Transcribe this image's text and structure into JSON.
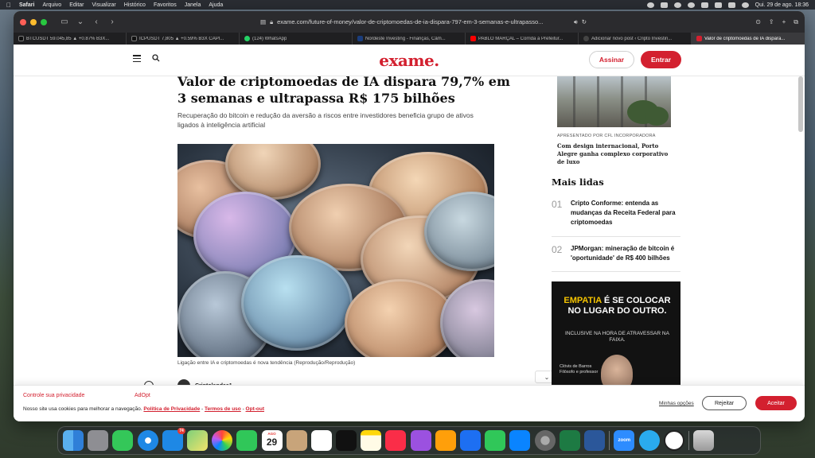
{
  "menubar": {
    "app": "Safari",
    "items": [
      "Arquivo",
      "Editar",
      "Visualizar",
      "Histórico",
      "Favoritos",
      "Janela",
      "Ajuda"
    ],
    "clock": "Qui. 29 de ago.  18:36"
  },
  "browser": {
    "url": "exame.com/future-of-money/valor-de-criptomoedas-de-ia-dispara-797-em-3-semanas-e-ultrapasso...",
    "tabs": [
      {
        "label": "BTCUSDT 59.045,85 ▲ +0.87% B3X...",
        "color": "#111111"
      },
      {
        "label": "ICPUSDT 7,805 ▲ +0.59% B3X CAPI...",
        "color": "#111111"
      },
      {
        "label": "(124) WhatsApp",
        "color": "#25d366"
      },
      {
        "label": "Nordeste Investing - Finanças, Câm...",
        "color": "#1a3d7c"
      },
      {
        "label": "PABLO MARÇAL – Corrida à Prefeitur...",
        "color": "#ff0000"
      },
      {
        "label": "Adicionar novo post ‹ Cripto Investin...",
        "color": "#444444"
      },
      {
        "label": "Valor de criptomoedas de IA dispara...",
        "color": "#d3202f"
      }
    ]
  },
  "header": {
    "logo": "exame.",
    "assinar": "Assinar",
    "entrar": "Entrar"
  },
  "article": {
    "headline": "Valor de criptomoedas de IA dispara 79,7% em 3 semanas e ultrapassa R$ 175 bilhões",
    "subhead": "Recuperação do bitcoin e redução da aversão a riscos entre investidores beneficia grupo de ativos ligados à inteligência artificial",
    "caption": "Ligação entre IA e criptomoedas é nova tendência (Reprodução/Reprodução)",
    "author": "Criptolandaa1"
  },
  "sidebar": {
    "ad_sponsor": "APRESENTADO POR CFL INCORPORADORA",
    "ad_title": "Com design internacional, Porto Alegre ganha complexo corporativo de luxo",
    "mais_lidas_title": "Mais lidas",
    "mais_lidas": [
      {
        "num": "01",
        "title": "Cripto Conforme: entenda as mudanças da Receita Federal para criptomoedas"
      },
      {
        "num": "02",
        "title": "JPMorgan: mineração de bitcoin é 'oportunidade' de R$ 400 bilhões"
      }
    ],
    "banner": {
      "line1_highlight": "EMPATIA",
      "line1_rest": " É SE COLOCAR NO LUGAR DO OUTRO.",
      "line2": "INCLUSIVE NA HORA DE ATRAVESSAR NA FAIXA.",
      "person": "Clóvis de Barros",
      "role": "Filósofo e professor"
    }
  },
  "cookie": {
    "title": "Controle sua privacidade",
    "adopt": "AdOpt",
    "text": "Nosso site usa cookies para melhorar a navegação.",
    "link1": "Política de Privacidade",
    "link2": "Termos de uso",
    "link3": "Opt-out",
    "sep": " - ",
    "options": "Minhas opções",
    "reject": "Rejeitar",
    "accept": "Aceitar"
  },
  "dock": {
    "mail_badge": "74",
    "calendar_month": "AGO",
    "calendar_day": "29",
    "zoom_label": "zoom"
  }
}
